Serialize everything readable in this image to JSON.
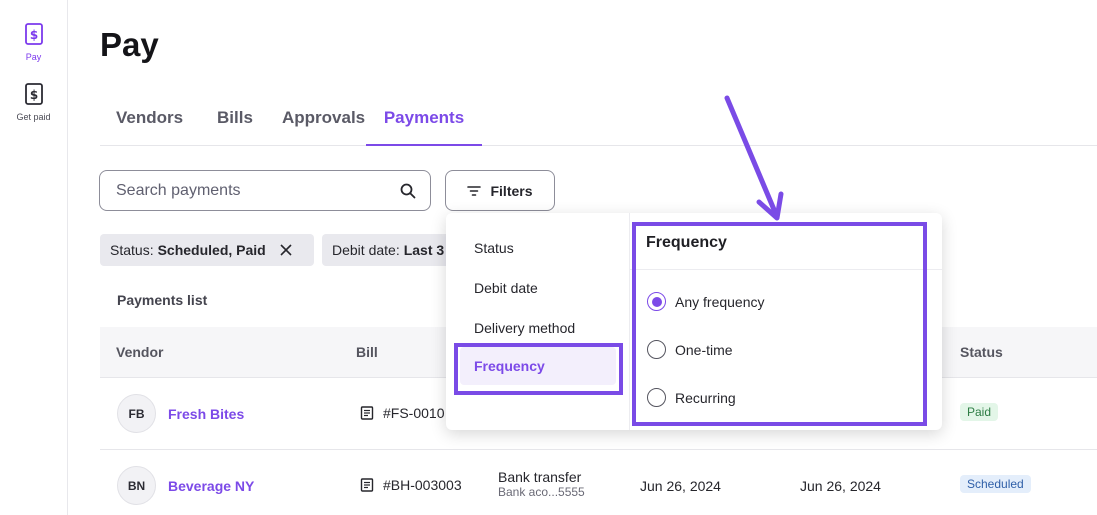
{
  "colors": {
    "accent": "#7c4ae8",
    "highlight": "#7a4be6",
    "paid_bg": "#e3f6e8",
    "scheduled_bg": "#e4eefb"
  },
  "rail": {
    "items": [
      {
        "label": "Pay",
        "icon": "dollar-document-icon",
        "active": true
      },
      {
        "label": "Get paid",
        "icon": "dollar-document-icon",
        "active": false
      }
    ]
  },
  "header": {
    "title": "Pay"
  },
  "tabs": [
    {
      "label": "Vendors"
    },
    {
      "label": "Bills"
    },
    {
      "label": "Approvals"
    },
    {
      "label": "Payments",
      "active": true
    }
  ],
  "search": {
    "placeholder": "Search payments",
    "icon": "search-icon"
  },
  "filters_button": {
    "label": "Filters",
    "icon": "filter-lines-icon"
  },
  "chips": [
    {
      "prefix": "Status:",
      "value": "Scheduled, Paid"
    },
    {
      "prefix": "Debit date:",
      "value": "Last 3"
    }
  ],
  "list_label": "Payments list",
  "table": {
    "headers": {
      "vendor": "Vendor",
      "bill": "Bill",
      "status": "Status"
    },
    "rows": [
      {
        "initials": "FB",
        "vendor": "Fresh Bites",
        "bill": "#FS-0010",
        "status": "Paid"
      },
      {
        "initials": "BN",
        "vendor": "Beverage NY",
        "bill": "#BH-003003",
        "method": "Bank transfer",
        "account": "Bank aco...5555",
        "debit_date": "Jun 26, 2024",
        "delivery_date": "Jun 26, 2024",
        "status": "Scheduled"
      }
    ]
  },
  "filter_menu": {
    "categories": [
      "Status",
      "Debit date",
      "Delivery method",
      "Frequency"
    ],
    "active_category": "Frequency",
    "panel_title": "Frequency",
    "options": [
      {
        "label": "Any frequency",
        "selected": true
      },
      {
        "label": "One-time",
        "selected": false
      },
      {
        "label": "Recurring",
        "selected": false
      }
    ]
  }
}
